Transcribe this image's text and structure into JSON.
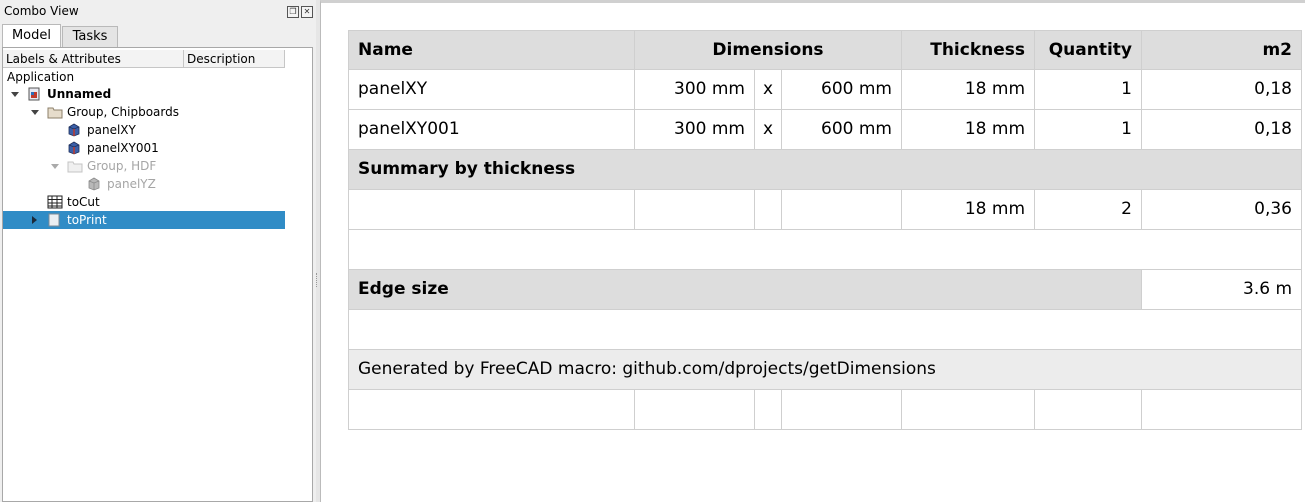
{
  "dock": {
    "title": "Combo View",
    "tabs": [
      "Model",
      "Tasks"
    ],
    "columns": [
      "Labels & Attributes",
      "Description"
    ],
    "tree": {
      "root": "Application",
      "document": "Unnamed",
      "group1": "Group, Chipboards",
      "panel1": "panelXY",
      "panel2": "panelXY001",
      "group2": "Group, HDF",
      "panel3": "panelYZ",
      "sheet1": "toCut",
      "sheet2": "toPrint"
    }
  },
  "table": {
    "headers": {
      "name": "Name",
      "dimensions": "Dimensions",
      "thickness": "Thickness",
      "quantity": "Quantity",
      "m2": "m2"
    },
    "rows": [
      {
        "name": "panelXY",
        "w": "300 mm",
        "x": "x",
        "h": "600 mm",
        "thickness": "18 mm",
        "qty": "1",
        "m2": "0,18"
      },
      {
        "name": "panelXY001",
        "w": "300 mm",
        "x": "x",
        "h": "600 mm",
        "thickness": "18 mm",
        "qty": "1",
        "m2": "0,18"
      }
    ],
    "summary_title": "Summary by thickness",
    "summary": {
      "thickness": "18 mm",
      "qty": "2",
      "m2": "0,36"
    },
    "edge_label": "Edge size",
    "edge_value": "3.6 m",
    "footer": "Generated by FreeCAD macro: github.com/dprojects/getDimensions"
  },
  "colors": {
    "selection": "#308cc6",
    "header_bg": "#dddddd",
    "footer_bg": "#ececec"
  }
}
